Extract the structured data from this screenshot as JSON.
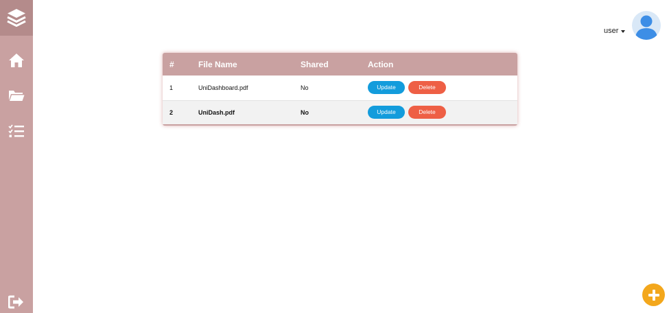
{
  "header": {
    "user_label": "user"
  },
  "table": {
    "columns": [
      "#",
      "File Name",
      "Shared",
      "Action"
    ],
    "rows": [
      {
        "num": "1",
        "file_name": "UniDashboard.pdf",
        "shared": "No",
        "update_label": "Update",
        "delete_label": "Delete"
      },
      {
        "num": "2",
        "file_name": "UniDash.pdf",
        "shared": "No",
        "update_label": "Update",
        "delete_label": "Delete"
      }
    ]
  },
  "sidebar": {
    "items": [
      {
        "icon": "layers-icon"
      },
      {
        "icon": "home-icon"
      },
      {
        "icon": "folder-open-icon"
      },
      {
        "icon": "tasks-icon"
      },
      {
        "icon": "logout-icon"
      }
    ]
  },
  "fab": {
    "icon": "plus-icon"
  },
  "colors": {
    "sidebar": "#c9a1a1",
    "sidebar_logo": "#b48b8b",
    "table_header": "#c9a1a1",
    "update_button": "#139cdc",
    "delete_button": "#ee5f45",
    "fab": "#f3a71c"
  }
}
